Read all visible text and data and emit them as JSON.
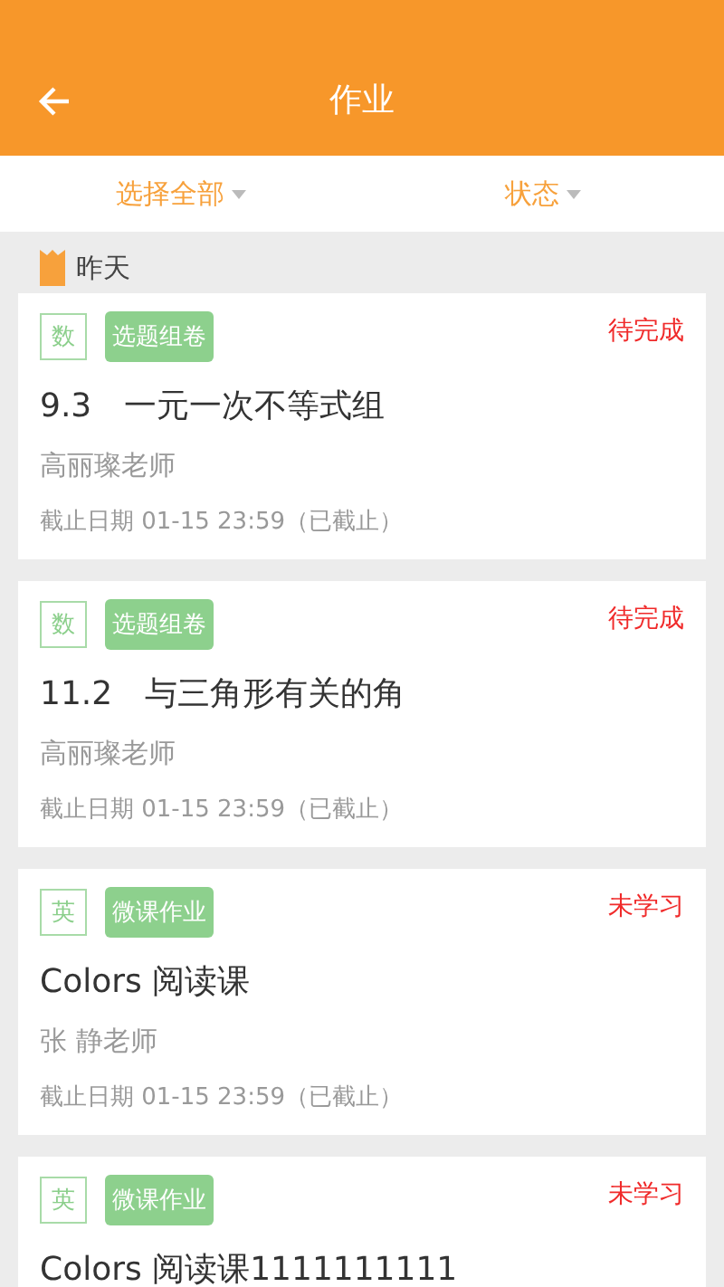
{
  "header": {
    "title": "作业"
  },
  "filters": [
    {
      "label": "选择全部"
    },
    {
      "label": "状态"
    }
  ],
  "section": {
    "label": "昨天"
  },
  "assignments": [
    {
      "subject": "数",
      "type": "选题组卷",
      "status": "待完成",
      "title": "9.3　一元一次不等式组",
      "teacher": "高丽璨老师",
      "deadline": "截止日期 01-15 23:59（已截止）"
    },
    {
      "subject": "数",
      "type": "选题组卷",
      "status": "待完成",
      "title": "11.2　与三角形有关的角",
      "teacher": "高丽璨老师",
      "deadline": "截止日期 01-15 23:59（已截止）"
    },
    {
      "subject": "英",
      "type": "微课作业",
      "status": "未学习",
      "title": "Colors 阅读课",
      "teacher": "张  静老师",
      "deadline": "截止日期 01-15 23:59（已截止）"
    },
    {
      "subject": "英",
      "type": "微课作业",
      "status": "未学习",
      "title": "Colors 阅读课1111111111"
    }
  ]
}
